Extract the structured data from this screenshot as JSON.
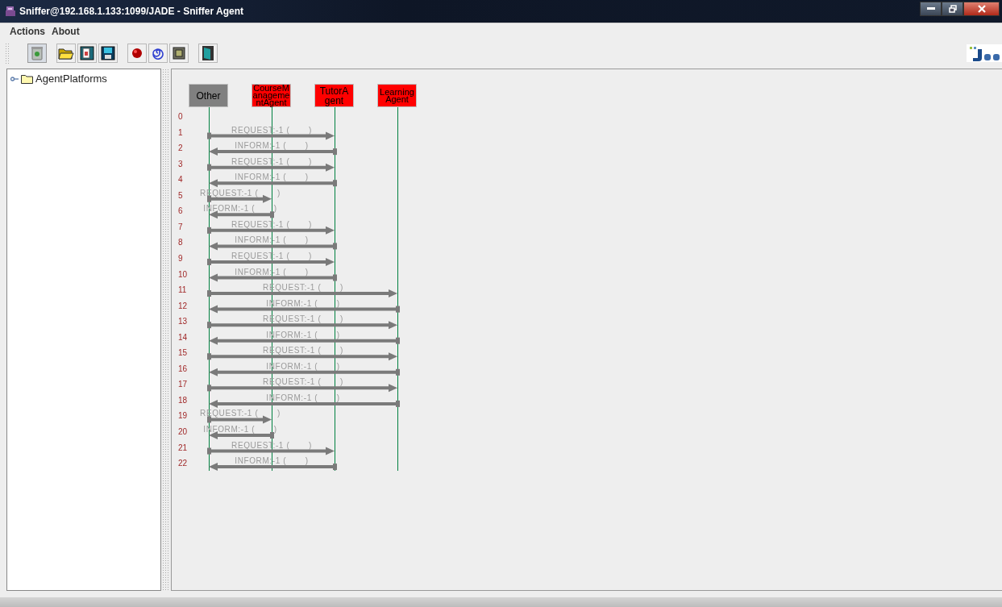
{
  "window": {
    "title": "Sniffer@192.168.1.133:1099/JADE - Sniffer Agent"
  },
  "menu": [
    "Actions",
    "About"
  ],
  "tree": {
    "items": [
      {
        "label": "AgentPlatforms",
        "expanded": false
      }
    ]
  },
  "agents": [
    {
      "name": "Other",
      "color": "#808080"
    },
    {
      "name": "CourseManagementAgent",
      "color": "#ff0000"
    },
    {
      "name": "TutorAgent",
      "color": "#ff0000"
    },
    {
      "name": "LearningAgent",
      "color": "#ff0000"
    }
  ],
  "rows": [
    {
      "number": "0"
    },
    {
      "number": "1",
      "kind": "right",
      "ends": [
        true,
        false,
        true,
        false
      ],
      "label": "REQUEST:-1 (       )"
    },
    {
      "number": "2",
      "kind": "left",
      "ends": [
        true,
        false,
        true,
        false
      ],
      "label": "INFORM:-1 (       )"
    },
    {
      "number": "3",
      "kind": "right",
      "ends": [
        true,
        false,
        true,
        false
      ],
      "label": "REQUEST:-1 (       )"
    },
    {
      "number": "4",
      "kind": "left",
      "ends": [
        true,
        false,
        true,
        false
      ],
      "label": "INFORM:-1 (       )"
    },
    {
      "number": "5",
      "kind": "right",
      "ends": [
        true,
        true,
        false,
        false
      ],
      "label": "REQUEST:-1 (       )"
    },
    {
      "number": "6",
      "kind": "left",
      "ends": [
        true,
        true,
        false,
        false
      ],
      "label": "INFORM:-1 (       )"
    },
    {
      "number": "7",
      "kind": "right",
      "ends": [
        true,
        false,
        true,
        false
      ],
      "label": "REQUEST:-1 (       )"
    },
    {
      "number": "8",
      "kind": "left",
      "ends": [
        true,
        false,
        true,
        false
      ],
      "label": "INFORM:-1 (       )"
    },
    {
      "number": "9",
      "kind": "right",
      "ends": [
        true,
        false,
        true,
        false
      ],
      "label": "REQUEST:-1 (       )"
    },
    {
      "number": "10",
      "kind": "left",
      "ends": [
        true,
        false,
        true,
        false
      ],
      "label": "INFORM:-1 (       )"
    },
    {
      "number": "11",
      "kind": "right",
      "ends": [
        true,
        false,
        false,
        true
      ],
      "label": "REQUEST:-1 (       )"
    },
    {
      "number": "12",
      "kind": "left",
      "ends": [
        true,
        false,
        false,
        true
      ],
      "label": "INFORM:-1 (       )"
    },
    {
      "number": "13",
      "kind": "right",
      "ends": [
        true,
        false,
        false,
        true
      ],
      "label": "REQUEST:-1 (       )"
    },
    {
      "number": "14",
      "kind": "left",
      "ends": [
        true,
        false,
        false,
        true
      ],
      "label": "INFORM:-1 (       )"
    },
    {
      "number": "15",
      "kind": "right",
      "ends": [
        true,
        false,
        false,
        true
      ],
      "label": "REQUEST:-1 (       )"
    },
    {
      "number": "16",
      "kind": "left",
      "ends": [
        true,
        false,
        false,
        true
      ],
      "label": "INFORM:-1 (       )"
    },
    {
      "number": "17",
      "kind": "right",
      "ends": [
        true,
        false,
        false,
        true
      ],
      "label": "REQUEST:-1 (       )"
    },
    {
      "number": "18",
      "kind": "left",
      "ends": [
        true,
        false,
        false,
        true
      ],
      "label": "INFORM:-1 (       )"
    },
    {
      "number": "19",
      "kind": "right",
      "ends": [
        true,
        true,
        false,
        false
      ],
      "label": "REQUEST:-1 (       )"
    },
    {
      "number": "20",
      "kind": "left",
      "ends": [
        true,
        true,
        false,
        false
      ],
      "label": "INFORM:-1 (       )"
    },
    {
      "number": "21",
      "kind": "right",
      "ends": [
        true,
        false,
        true,
        false
      ],
      "label": "REQUEST:-1 (       )"
    },
    {
      "number": "22",
      "kind": "left",
      "ends": [
        true,
        false,
        true,
        false
      ],
      "label": "INFORM:-1 (       )"
    }
  ]
}
